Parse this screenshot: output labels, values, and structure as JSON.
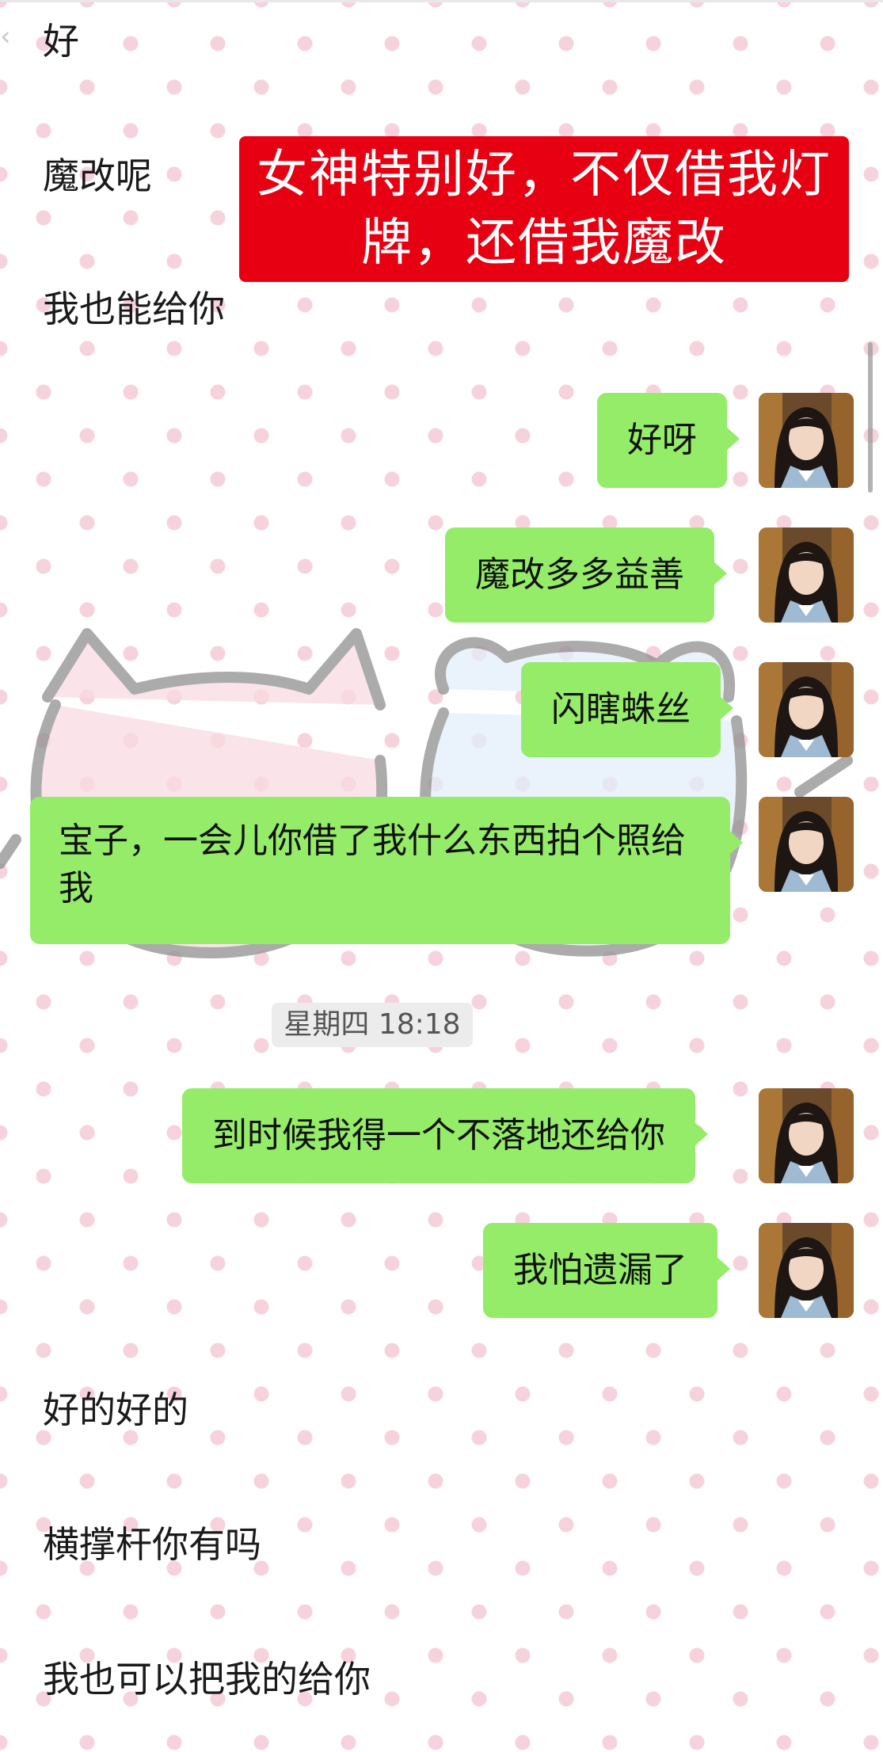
{
  "messages_top": [
    {
      "text": "好"
    },
    {
      "text": "魔改呢"
    },
    {
      "text": "我也能给你"
    }
  ],
  "banner": {
    "line1": "女神特别好，不仅借我灯",
    "line2": "牌，还借我魔改"
  },
  "sent": [
    {
      "text": "好呀"
    },
    {
      "text": "魔改多多益善"
    },
    {
      "text": "闪瞎蛛丝"
    },
    {
      "text": "宝子，一会儿你借了我什么东西拍个照给我"
    }
  ],
  "timestamp": "星期四 18:18",
  "sent_after": [
    {
      "text": "到时候我得一个不落地还给你"
    },
    {
      "text": "我怕遗漏了"
    }
  ],
  "messages_bottom": [
    {
      "text": "好的好的"
    },
    {
      "text": "横撑杆你有吗"
    },
    {
      "text": "我也可以把我的给你"
    }
  ],
  "colors": {
    "bubble": "#95ec69",
    "banner": "#e60012",
    "dots": "#f6d3dc"
  }
}
